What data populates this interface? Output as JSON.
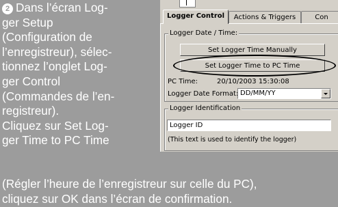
{
  "instructions": {
    "step_number": "2",
    "lines": [
      "Dans l’écran Log-",
      "ger Setup",
      "(Configuration de",
      "l’enregistreur), sélec-",
      "tionnez l’onglet Log-",
      "ger Control",
      "(Commandes de l’en-",
      "registreur).",
      "Cliquez sur Set Log-",
      "ger Time to PC Time"
    ],
    "bottom_lines": [
      "(Régler l’heure de l’enregistreur sur celle du PC),",
      "cliquez sur OK dans l’écran de confirmation."
    ]
  },
  "screenshot": {
    "tabs": [
      {
        "label": "Logger Control",
        "active": true
      },
      {
        "label": "Actions & Triggers",
        "active": false
      },
      {
        "label": "Con",
        "active": false
      }
    ],
    "date_time_group": {
      "label": "Logger Date / Time:",
      "set_manual_button": "Set Logger Time Manually",
      "set_pc_button": "Set Logger Time to PC Time",
      "pc_time_label": "PC Time:",
      "pc_time_value": "20/10/2003 15:30:08",
      "date_format_label": "Logger Date Format:",
      "date_format_value": "DD/MM/YY"
    },
    "identification_group": {
      "label": "Logger Identification",
      "id_value": "Logger ID",
      "hint": "(This text is used to identify the logger)"
    }
  }
}
